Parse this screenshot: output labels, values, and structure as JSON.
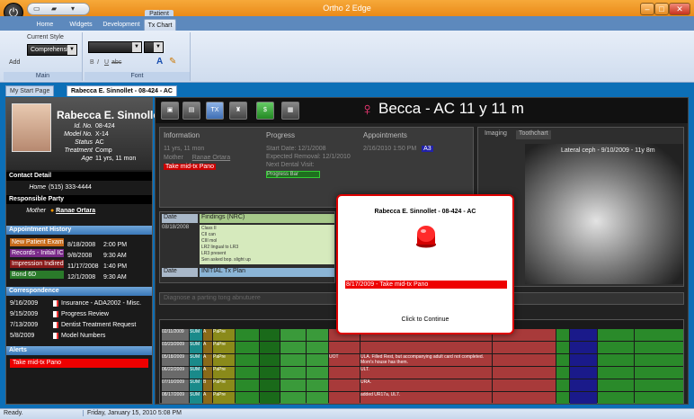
{
  "window": {
    "title": "Ortho 2 Edge",
    "context_tab_group": "Patient",
    "buttons": [
      "–",
      "□",
      "✕"
    ]
  },
  "ribbon": {
    "tabs": [
      "Home",
      "Widgets",
      "Development",
      "Tx Chart"
    ],
    "active_tab": "Tx Chart",
    "current_style_label": "Current Style",
    "style_value": "Comprehensive",
    "add_label": "Add",
    "groups": [
      "Main",
      "Font"
    ]
  },
  "doc_tabs": [
    "My Start Page",
    "Rabecca E. Sinnollet - 08-424 - AC"
  ],
  "patient": {
    "name": "Rabecca E. Sinnollet",
    "fields": [
      {
        "k": "Id. No.",
        "v": "08-424"
      },
      {
        "k": "Model No.",
        "v": "X-14"
      },
      {
        "k": "Status",
        "v": "AC"
      },
      {
        "k": "Treatment",
        "v": "Comp"
      },
      {
        "k": "Age",
        "v": "11 yrs, 11 mon"
      }
    ],
    "contact_detail_label": "Contact Detail",
    "home_label": "Home",
    "home_phone": "(515) 333-4444",
    "responsible_party_label": "Responsible Party",
    "mother_label": "Mother",
    "mother_name": "Ranae Ortara"
  },
  "appointment_history": {
    "title": "Appointment History",
    "rows": [
      {
        "label": "New Patient Exam",
        "date": "8/18/2008",
        "time": "2:00 PM",
        "color": "#c76a1a"
      },
      {
        "label": "Records - Initial IC",
        "date": "9/8/2008",
        "time": "9:30 AM",
        "color": "#7a2a8a"
      },
      {
        "label": "Impression Indired",
        "date": "11/17/2008",
        "time": "1:40 PM",
        "color": "#8a1a1a"
      },
      {
        "label": "Bond 6D",
        "date": "12/1/2008",
        "time": "9:30 AM",
        "color": "#2a7a2a"
      }
    ]
  },
  "correspondence": {
    "title": "Correspondence",
    "rows": [
      {
        "date": "9/16/2009",
        "text": "Insurance - ADA2002 - Misc."
      },
      {
        "date": "9/15/2009",
        "text": "Progress Review"
      },
      {
        "date": "7/13/2009",
        "text": "Dentist Treatment Request"
      },
      {
        "date": "5/8/2009",
        "text": "Model Numbers"
      }
    ]
  },
  "alerts": {
    "title": "Alerts",
    "items": [
      "Take mid-tx Pano"
    ]
  },
  "banner": {
    "text": "Becca - AC    11 y 11 m",
    "toolbar_icons": [
      "image-icon",
      "notes-icon",
      "tx-icon",
      "chair-icon",
      "dollar-icon",
      "calendar-icon"
    ],
    "tx_label": "TX"
  },
  "info_panel": {
    "headers": [
      "Information",
      "Progress",
      "Appointments"
    ],
    "age": "11 yrs, 11 mon",
    "mother_label": "Mother",
    "mother_name": "Ranae Ortara",
    "alert_pill": "Take mid-tx Pano",
    "start_date_label": "Start Date:",
    "start_date": "12/1/2008",
    "removal_label": "Expected Removal:",
    "removal": "12/1/2010",
    "next_visit_label": "Next Dental Visit:",
    "appt_date": "2/16/2010 1:50 PM",
    "appt_code": "A3",
    "progress_button": "Progress Bar"
  },
  "imaging": {
    "tabs": [
      "Imaging",
      "Toothchart"
    ],
    "caption": "Lateral ceph - 9/10/2009 - 11y 8m"
  },
  "notes": {
    "date_header": "Date",
    "findings_header": "Findings (NRC)",
    "date": "08/18/2008",
    "lines": [
      "Class II",
      "CII can",
      "CIII mol",
      "LR2 lingual to LR3",
      "LR3 present",
      "Sen asked bop. slight up"
    ],
    "plan_label": "Date",
    "plan_value": "INITIAL Tx Plan",
    "placeholder": "Diagnose a parting tong abnutuere"
  },
  "grid_rows": [
    {
      "date": "02/11/2009",
      "a": "SUM",
      "b": "A",
      "c": "PaPre",
      "wire": "",
      "note": ""
    },
    {
      "date": "03/23/2009",
      "a": "SUM",
      "b": "A",
      "c": "PaPre",
      "wire": "",
      "note": ""
    },
    {
      "date": "05/18/2009",
      "a": "SUM",
      "b": "A",
      "c": "PaPre",
      "wire": "UOT",
      "note": "ULA. Filled Rest, but accompanying adult card not completed. Mom's house has them."
    },
    {
      "date": "06/22/2009",
      "a": "SUM",
      "b": "A",
      "c": "PaPre",
      "wire": "",
      "note": "ULT."
    },
    {
      "date": "07/10/2009",
      "a": "SUM",
      "b": "B",
      "c": "PaPre",
      "wire": "",
      "note": "URA."
    },
    {
      "date": "08/17/2009",
      "a": "SUM",
      "b": "A",
      "c": "PaPre",
      "wire": "",
      "note": "added UR17a, UL7."
    }
  ],
  "modal": {
    "title": "Rabecca E. Sinnollet - 08-424 - AC",
    "alert": "8/17/2009 - Take mid-tx Pano",
    "continue": "Click to Continue"
  },
  "status": {
    "left": "Ready.",
    "datetime": "Friday, January 15, 2010 5:08 PM"
  }
}
